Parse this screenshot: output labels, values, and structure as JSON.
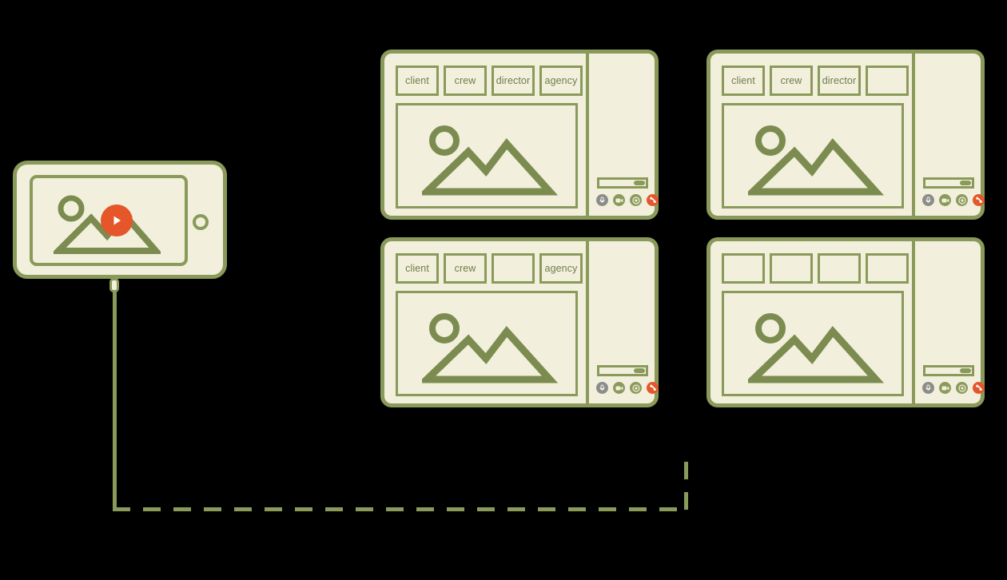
{
  "diagram": {
    "title": "Video review session distribution diagram",
    "colors": {
      "background": "#000000",
      "panel_fill": "#f2f0dc",
      "outline_green": "#8a9a5b",
      "label_green": "#6f7d4a",
      "accent_orange": "#e5562a",
      "mute_gray": "#8c8c8c"
    }
  },
  "source_device": {
    "name": "mobile-phone",
    "orientation": "landscape",
    "screen_content_icon": "image-placeholder-icon",
    "overlay_icon": "play-button-icon",
    "home_button_icon": "home-button-icon",
    "connector_icon": "cable-connector-icon"
  },
  "connector": {
    "vertical_solid": "solid",
    "horizontal": "dashed",
    "vertical_dashed": "dashed"
  },
  "controls": {
    "slider_name": "volume-slider",
    "slider_value": 85,
    "buttons": [
      {
        "name": "mute-microphone-button",
        "icon": "microphone-icon",
        "state": "muted",
        "color": "#8c8c8c"
      },
      {
        "name": "video-toggle-button",
        "icon": "video-camera-icon",
        "state": "active",
        "color": "#8a9a5b"
      },
      {
        "name": "record-button",
        "icon": "record-dot-icon",
        "state": "active",
        "color": "#8a9a5b"
      },
      {
        "name": "hang-up-button",
        "icon": "phone-hangup-icon",
        "state": "end-call",
        "color": "#e5562a"
      }
    ]
  },
  "panels": [
    {
      "id": "panel-top-left",
      "position": "top-left",
      "tabs": [
        {
          "label": "client"
        },
        {
          "label": "crew"
        },
        {
          "label": "director"
        },
        {
          "label": "agency"
        }
      ],
      "viewer_icon": "image-placeholder-icon"
    },
    {
      "id": "panel-top-right",
      "position": "top-right",
      "tabs": [
        {
          "label": "client"
        },
        {
          "label": "crew"
        },
        {
          "label": "director"
        },
        {
          "label": ""
        }
      ],
      "viewer_icon": "image-placeholder-icon"
    },
    {
      "id": "panel-bottom-left",
      "position": "bottom-left",
      "tabs": [
        {
          "label": "client"
        },
        {
          "label": "crew"
        },
        {
          "label": ""
        },
        {
          "label": "agency"
        }
      ],
      "viewer_icon": "image-placeholder-icon"
    },
    {
      "id": "panel-bottom-right",
      "position": "bottom-right",
      "tabs": [
        {
          "label": ""
        },
        {
          "label": ""
        },
        {
          "label": ""
        },
        {
          "label": ""
        }
      ],
      "viewer_icon": "image-placeholder-icon"
    }
  ]
}
